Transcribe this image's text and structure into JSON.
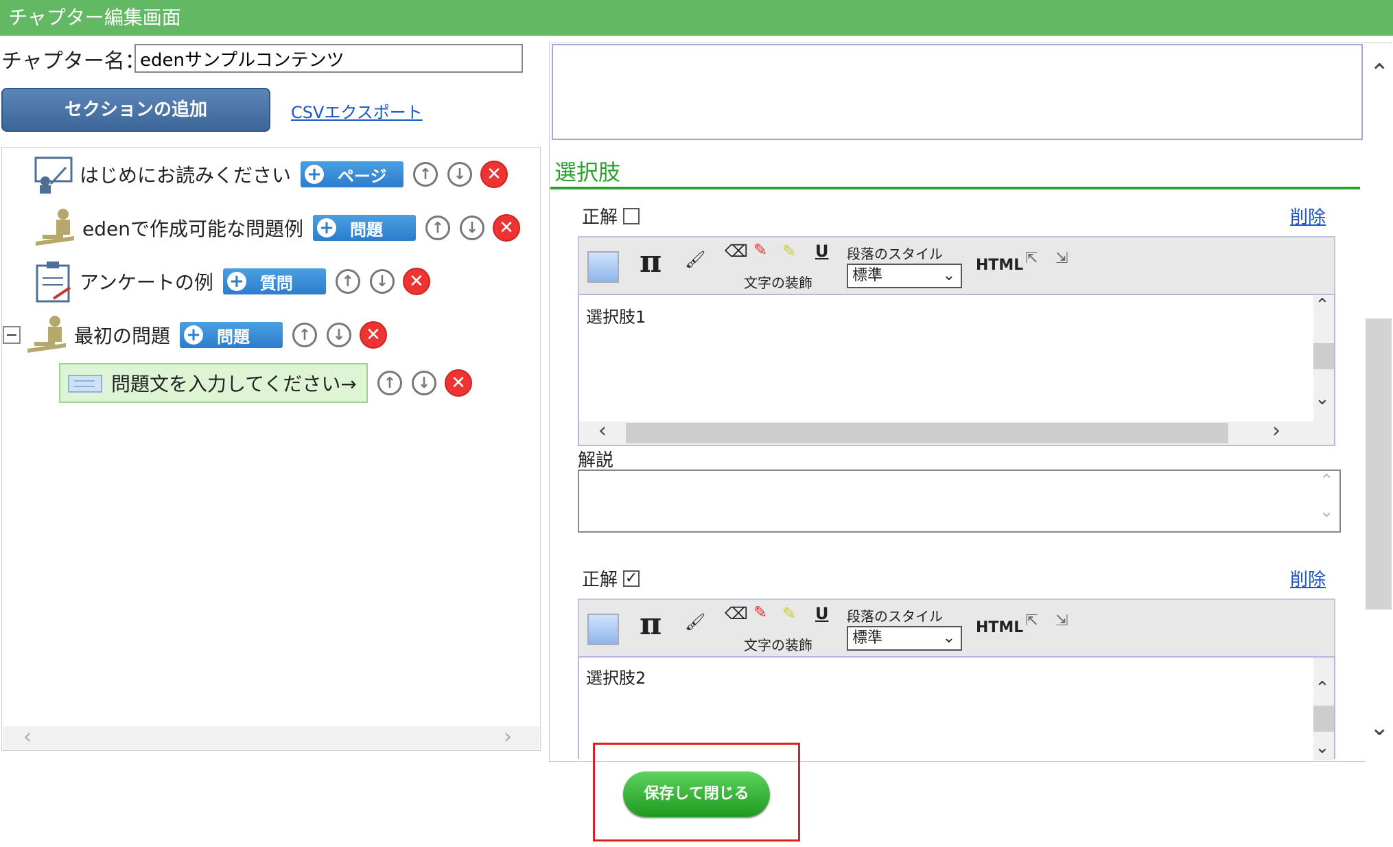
{
  "window": {
    "title": "チャプター編集画面"
  },
  "chapter": {
    "label": "チャプター名：",
    "name_value": "edenサンプルコンテンツ"
  },
  "actions": {
    "add_section": "セクションの追加",
    "csv_export": "CSVエクスポート"
  },
  "tree": {
    "items": [
      {
        "label": "はじめにお読みください",
        "tag": "ページ",
        "icon": "presentation-icon"
      },
      {
        "label": "edenで作成可能な問題例",
        "tag": "問題",
        "icon": "person-desk-icon"
      },
      {
        "label": "アンケートの例",
        "tag": "質問",
        "icon": "clipboard-icon"
      },
      {
        "label": "最初の問題",
        "tag": "問題",
        "icon": "person-desk-icon",
        "collapse": "−"
      }
    ],
    "sub_item": {
      "label": "問題文を入力してください→"
    }
  },
  "choices": {
    "heading": "選択肢",
    "items": [
      {
        "correct_label": "正解",
        "checked": false,
        "check_mark": "",
        "delete": "削除",
        "text": "選択肢1"
      },
      {
        "correct_label": "正解",
        "checked": true,
        "check_mark": "✓",
        "delete": "削除",
        "text": "選択肢2"
      }
    ],
    "toolbar": {
      "pi": "π",
      "underline": "U",
      "text_decoration": "文字の装飾",
      "paragraph_style": "段落のスタイル",
      "paragraph_value": "標準",
      "html": "HTML"
    },
    "explanation_label": "解説"
  },
  "footer": {
    "save_close": "保存して閉じる"
  },
  "colors": {
    "title_bar": "#63b864",
    "section_heading": "#2ca02c",
    "link": "#1a56c7",
    "highlight": "#e02020"
  }
}
